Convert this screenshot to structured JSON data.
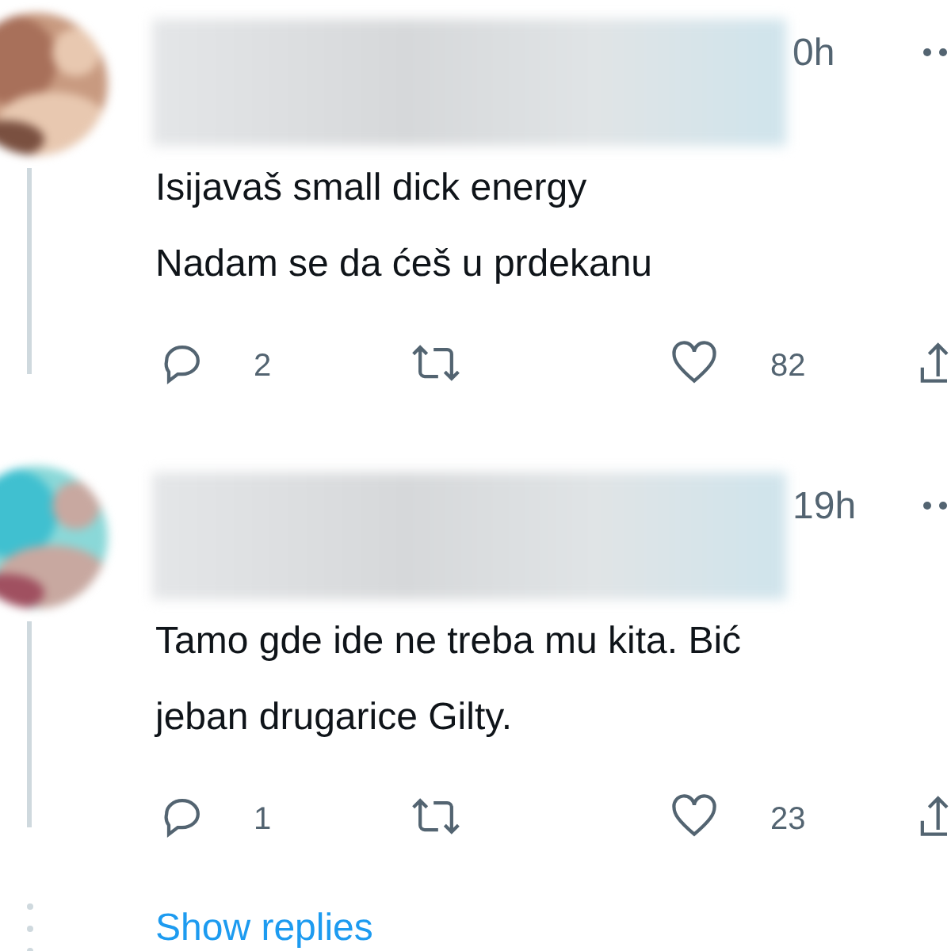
{
  "replies": [
    {
      "time": "0h",
      "text_lines": [
        "Isijavaš small dick energy",
        "Nadam se da ćeš u prdekanu"
      ],
      "reply_count": "2",
      "like_count": "82"
    },
    {
      "time": "19h",
      "text_lines": [
        "Tamo gde ide ne treba mu kita. Bić",
        "jeban drugarice Gilty."
      ],
      "reply_count": "1",
      "like_count": "23"
    }
  ],
  "show_replies": "Show replies"
}
